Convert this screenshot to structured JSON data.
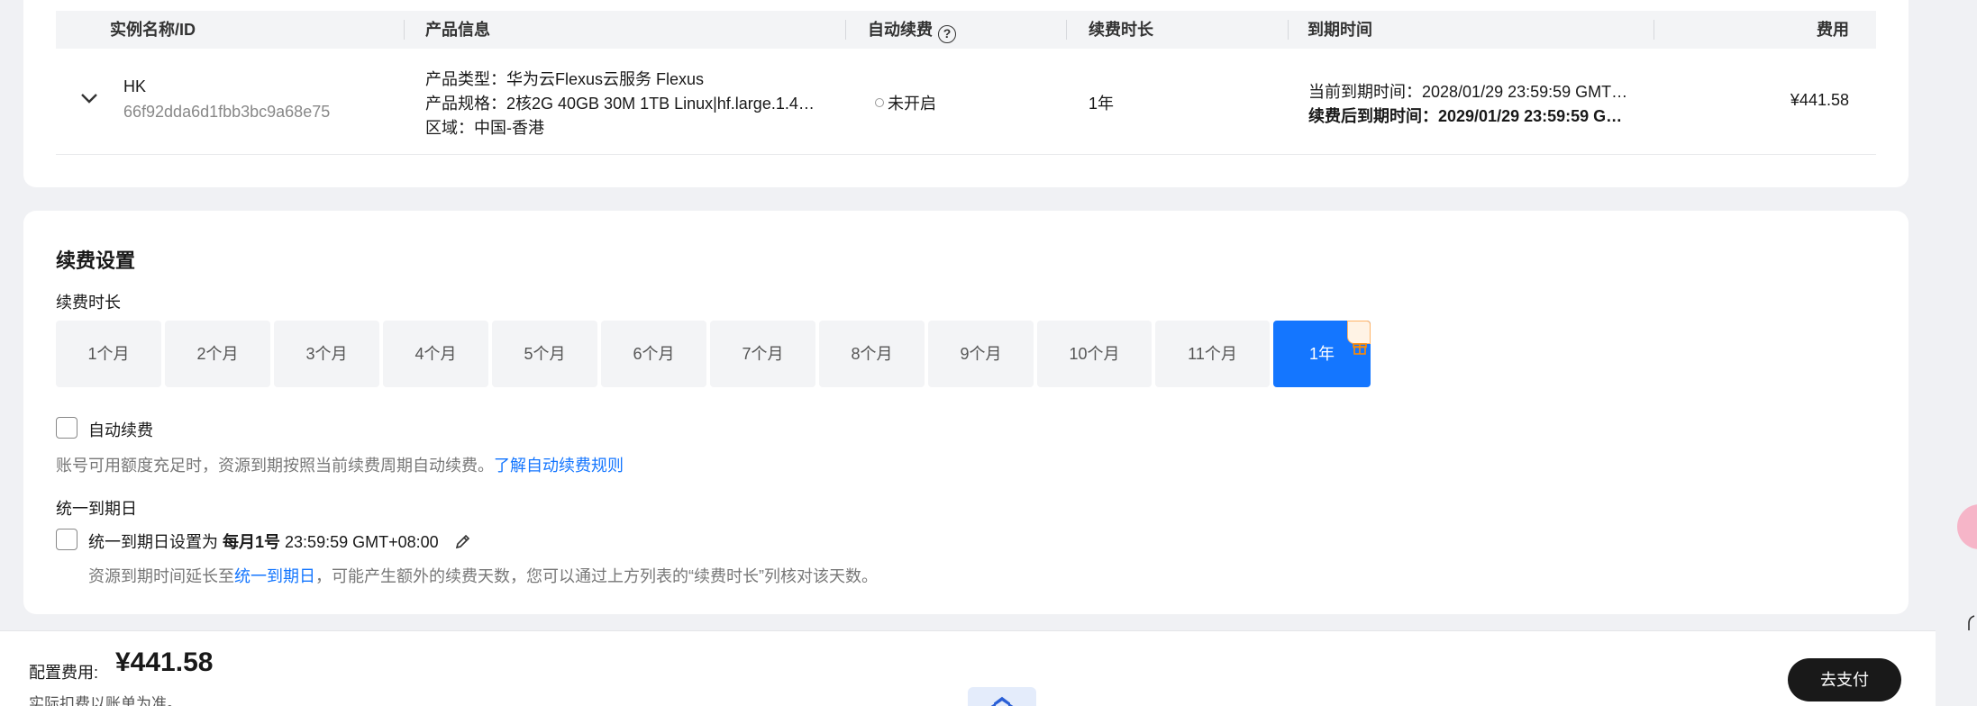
{
  "table": {
    "headers": {
      "instance": "实例名称/ID",
      "product": "产品信息",
      "auto_renew": "自动续费",
      "duration": "续费时长",
      "expiry": "到期时间",
      "cost": "费用"
    },
    "row": {
      "name": "HK",
      "id": "66f92dda6d1fbb3bc9a68e75",
      "product_type": "产品类型：华为云Flexus云服务 Flexus",
      "product_spec": "产品规格：2核2G 40GB 30M 1TB Linux|hf.large.1.4…",
      "region": "区域：中国-香港",
      "auto_renew_status": "未开启",
      "duration": "1年",
      "current_expiry": "当前到期时间：2028/01/29 23:59:59 GMT…",
      "renewed_expiry": "续费后到期时间：2029/01/29 23:59:59 G…",
      "cost": "¥441.58"
    }
  },
  "renew": {
    "title": "续费设置",
    "duration_label": "续费时长",
    "durations": [
      "1个月",
      "2个月",
      "3个月",
      "4个月",
      "5个月",
      "6个月",
      "7个月",
      "8个月",
      "9个月",
      "10个月",
      "11个月",
      "1年"
    ],
    "selected_duration": "1年",
    "auto_renew_label": "自动续费",
    "auto_renew_hint": "账号可用额度充足时，资源到期按照当前续费周期自动续费。",
    "auto_renew_link": "了解自动续费规则",
    "unify_title": "统一到期日",
    "unify_prefix": "统一到期日设置为 ",
    "unify_day": "每月1号",
    "unify_time": " 23:59:59 GMT+08:00",
    "unify_hint_prefix": "资源到期时间延长至",
    "unify_hint_link": "统一到期日",
    "unify_hint_suffix": "，可能产生额外的续费天数，您可以通过上方列表的“续费时长”列核对该天数。"
  },
  "footer": {
    "fee_label": "配置费用:",
    "fee_value": "¥441.58",
    "note": "实际扣费以账单为准。",
    "pay_button": "去支付"
  },
  "colors": {
    "accent": "#1476ff",
    "pay_button": "#191919"
  },
  "icons": [
    "chevron-down-icon",
    "help-icon",
    "gift-icon",
    "edit-icon",
    "status-circle-icon"
  ]
}
